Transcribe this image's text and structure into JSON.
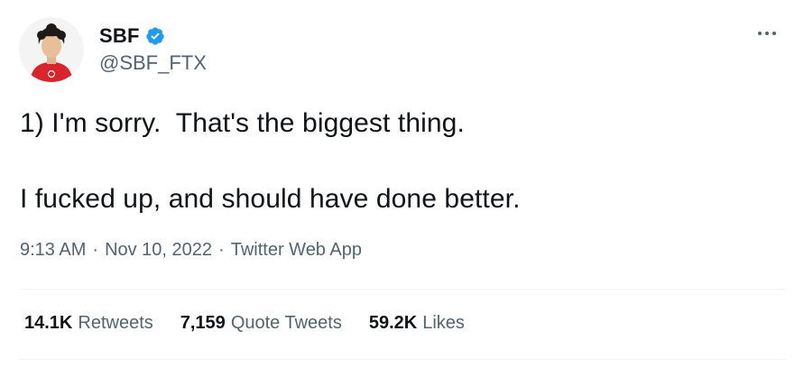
{
  "author": {
    "display_name": "SBF",
    "handle": "@SBF_FTX",
    "verified": true,
    "verified_color": "#1d9bf0"
  },
  "tweet": {
    "lines": [
      "1) I'm sorry.  That's the biggest thing.",
      "I fucked up, and should have done better."
    ],
    "time": "9:13 AM",
    "date": "Nov 10, 2022",
    "source": "Twitter Web App",
    "separator": "·"
  },
  "stats": {
    "retweets_count": "14.1K",
    "retweets_label": "Retweets",
    "quote_count": "7,159",
    "quote_label": "Quote Tweets",
    "likes_count": "59.2K",
    "likes_label": "Likes"
  },
  "icons": {
    "more": "more-horizontal-icon",
    "verified": "verified-badge-icon"
  },
  "colors": {
    "text_primary": "#0f1419",
    "text_secondary": "#536471",
    "divider": "#eff3f4",
    "accent": "#1d9bf0"
  }
}
